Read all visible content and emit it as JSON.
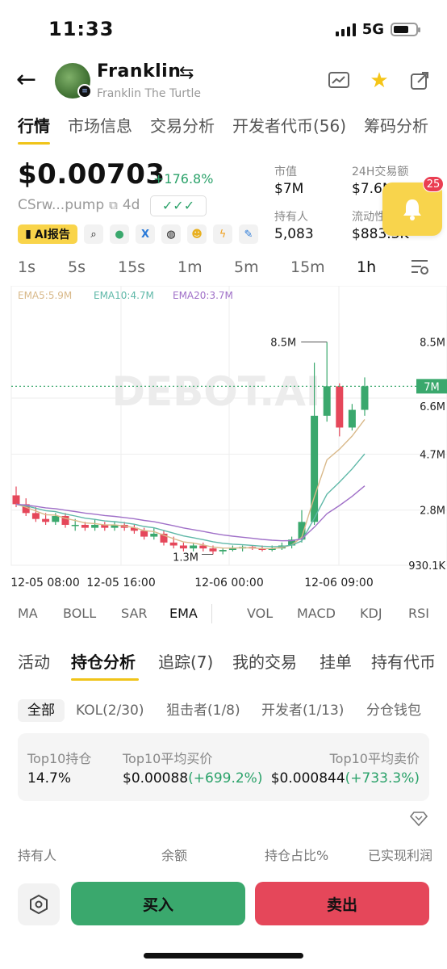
{
  "status": {
    "time": "11:33",
    "network": "5G"
  },
  "header": {
    "title": "Franklin",
    "subtitle": "Franklin The Turtle"
  },
  "tabs": [
    "行情",
    "市场信息",
    "交易分析",
    "开发者代币(56)",
    "筹码分析"
  ],
  "token": {
    "price": "$0.00703",
    "change": "+176.8%",
    "address": "CSrw...pump",
    "age": "4d",
    "checks": "✓✓✓"
  },
  "ai_report": "AI报告",
  "stats": {
    "market_cap_label": "市值",
    "market_cap": "$7M",
    "volume_label": "24H交易额",
    "volume": "$7.6M",
    "holders_label": "持有人",
    "holders": "5,083",
    "liquidity_label": "流动性",
    "liquidity": "$883.3K"
  },
  "notifications": "25",
  "intervals": [
    "1s",
    "5s",
    "15s",
    "1m",
    "5m",
    "15m",
    "1h"
  ],
  "chart_data": {
    "type": "candlestick",
    "ema_legend": [
      {
        "name": "EMA5:5.9M",
        "color": "#d9b98a"
      },
      {
        "name": "EMA10:4.7M",
        "color": "#5fb8a8"
      },
      {
        "name": "EMA20:3.7M",
        "color": "#a070c8"
      }
    ],
    "y_ticks": [
      "8.5M",
      "6.6M",
      "4.7M",
      "2.8M",
      "930.1K"
    ],
    "current_label": "7M",
    "high_label": "8.5M",
    "low_label": "1.3M",
    "x_ticks": [
      "12-05 08:00",
      "12-05 16:00",
      "12-06 00:00",
      "12-06 09:00"
    ],
    "watermark": "DEBOT.AI",
    "ylim": [
      0.93,
      9.2
    ],
    "candles": [
      [
        3.3,
        3.0,
        3.6,
        2.9
      ],
      [
        3.0,
        2.7,
        3.2,
        2.6
      ],
      [
        2.7,
        2.5,
        2.9,
        2.4
      ],
      [
        2.5,
        2.4,
        2.7,
        2.3
      ],
      [
        2.4,
        2.6,
        2.7,
        2.3
      ],
      [
        2.6,
        2.3,
        2.7,
        2.2
      ],
      [
        2.3,
        2.3,
        2.5,
        2.1
      ],
      [
        2.3,
        2.2,
        2.4,
        2.1
      ],
      [
        2.2,
        2.3,
        2.5,
        2.1
      ],
      [
        2.3,
        2.2,
        2.4,
        2.1
      ],
      [
        2.2,
        2.3,
        2.4,
        2.1
      ],
      [
        2.3,
        2.2,
        2.4,
        2.1
      ],
      [
        2.2,
        2.1,
        2.3,
        2.0
      ],
      [
        2.1,
        1.9,
        2.2,
        1.8
      ],
      [
        1.9,
        2.0,
        2.2,
        1.8
      ],
      [
        2.0,
        1.7,
        2.1,
        1.6
      ],
      [
        1.7,
        1.6,
        1.9,
        1.5
      ],
      [
        1.6,
        1.5,
        1.7,
        1.4
      ],
      [
        1.5,
        1.6,
        1.7,
        1.4
      ],
      [
        1.6,
        1.5,
        1.7,
        1.4
      ],
      [
        1.5,
        1.4,
        1.6,
        1.3
      ],
      [
        1.4,
        1.45,
        1.5,
        1.3
      ],
      [
        1.45,
        1.5,
        1.6,
        1.4
      ],
      [
        1.5,
        1.55,
        1.6,
        1.4
      ],
      [
        1.55,
        1.5,
        1.6,
        1.45
      ],
      [
        1.5,
        1.45,
        1.6,
        1.4
      ],
      [
        1.45,
        1.5,
        1.6,
        1.4
      ],
      [
        1.5,
        1.6,
        1.7,
        1.45
      ],
      [
        1.6,
        1.8,
        1.9,
        1.5
      ],
      [
        1.8,
        2.4,
        2.8,
        1.7
      ],
      [
        2.4,
        6.0,
        7.8,
        2.3
      ],
      [
        6.0,
        7.0,
        8.5,
        5.8
      ],
      [
        7.0,
        5.6,
        7.1,
        5.3
      ],
      [
        5.6,
        6.2,
        6.4,
        5.5
      ],
      [
        6.2,
        7.0,
        7.3,
        6.0
      ]
    ]
  },
  "indicators": [
    "MA",
    "BOLL",
    "SAR",
    "EMA",
    "VOL",
    "MACD",
    "KDJ",
    "RSI"
  ],
  "section_tabs": [
    "活动",
    "持仓分析",
    "追踪(7)",
    "我的交易",
    "挂单",
    "持有代币"
  ],
  "filters": [
    "全部",
    "KOL(2/30)",
    "狙击者(1/8)",
    "开发者(1/13)",
    "分仓钱包"
  ],
  "summary": {
    "top10_hold_label": "Top10持仓",
    "top10_hold": "14.7%",
    "avg_buy_label": "Top10平均买价",
    "avg_buy": "$0.00088",
    "avg_buy_pct": "(+699.2%)",
    "avg_sell_label": "Top10平均卖价",
    "avg_sell": "$0.000844",
    "avg_sell_pct": "(+733.3%)"
  },
  "table_headers": [
    "持有人",
    "余额",
    "持仓占比%",
    "已实现利润"
  ],
  "actions": {
    "buy": "买入",
    "sell": "卖出"
  }
}
